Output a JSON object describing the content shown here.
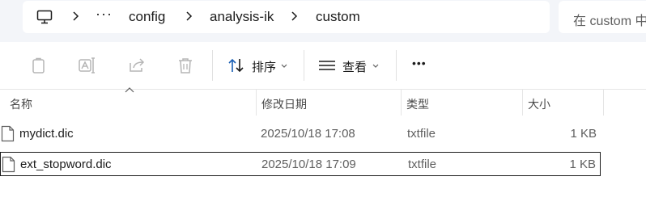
{
  "breadcrumb": {
    "root_icon": "computer-icon",
    "overflow": "···",
    "items": [
      "config",
      "analysis-ik",
      "custom"
    ]
  },
  "search": {
    "placeholder": "在 custom 中搜索"
  },
  "toolbar": {
    "buttons": [
      {
        "name": "copy",
        "icon": "copy-icon",
        "enabled": false
      },
      {
        "name": "rename",
        "icon": "rename-icon",
        "enabled": false
      },
      {
        "name": "share",
        "icon": "share-icon",
        "enabled": false
      },
      {
        "name": "delete",
        "icon": "trash-icon",
        "enabled": false
      }
    ],
    "sort_label": "排序",
    "view_label": "查看",
    "more_label": "•••"
  },
  "columns": {
    "name": "名称",
    "date": "修改日期",
    "type": "类型",
    "size": "大小"
  },
  "files": [
    {
      "name": "mydict.dic",
      "date": "2025/10/18 17:08",
      "type": "txtfile",
      "size": "1 KB",
      "selected": false
    },
    {
      "name": "ext_stopword.dic",
      "date": "2025/10/18 17:09",
      "type": "txtfile",
      "size": "1 KB",
      "selected": true
    }
  ],
  "colors": {
    "topbar_bg": "#f3f5f9",
    "disabled_icon": "#b5b5b5",
    "accent_blue": "#1a5fb4"
  }
}
